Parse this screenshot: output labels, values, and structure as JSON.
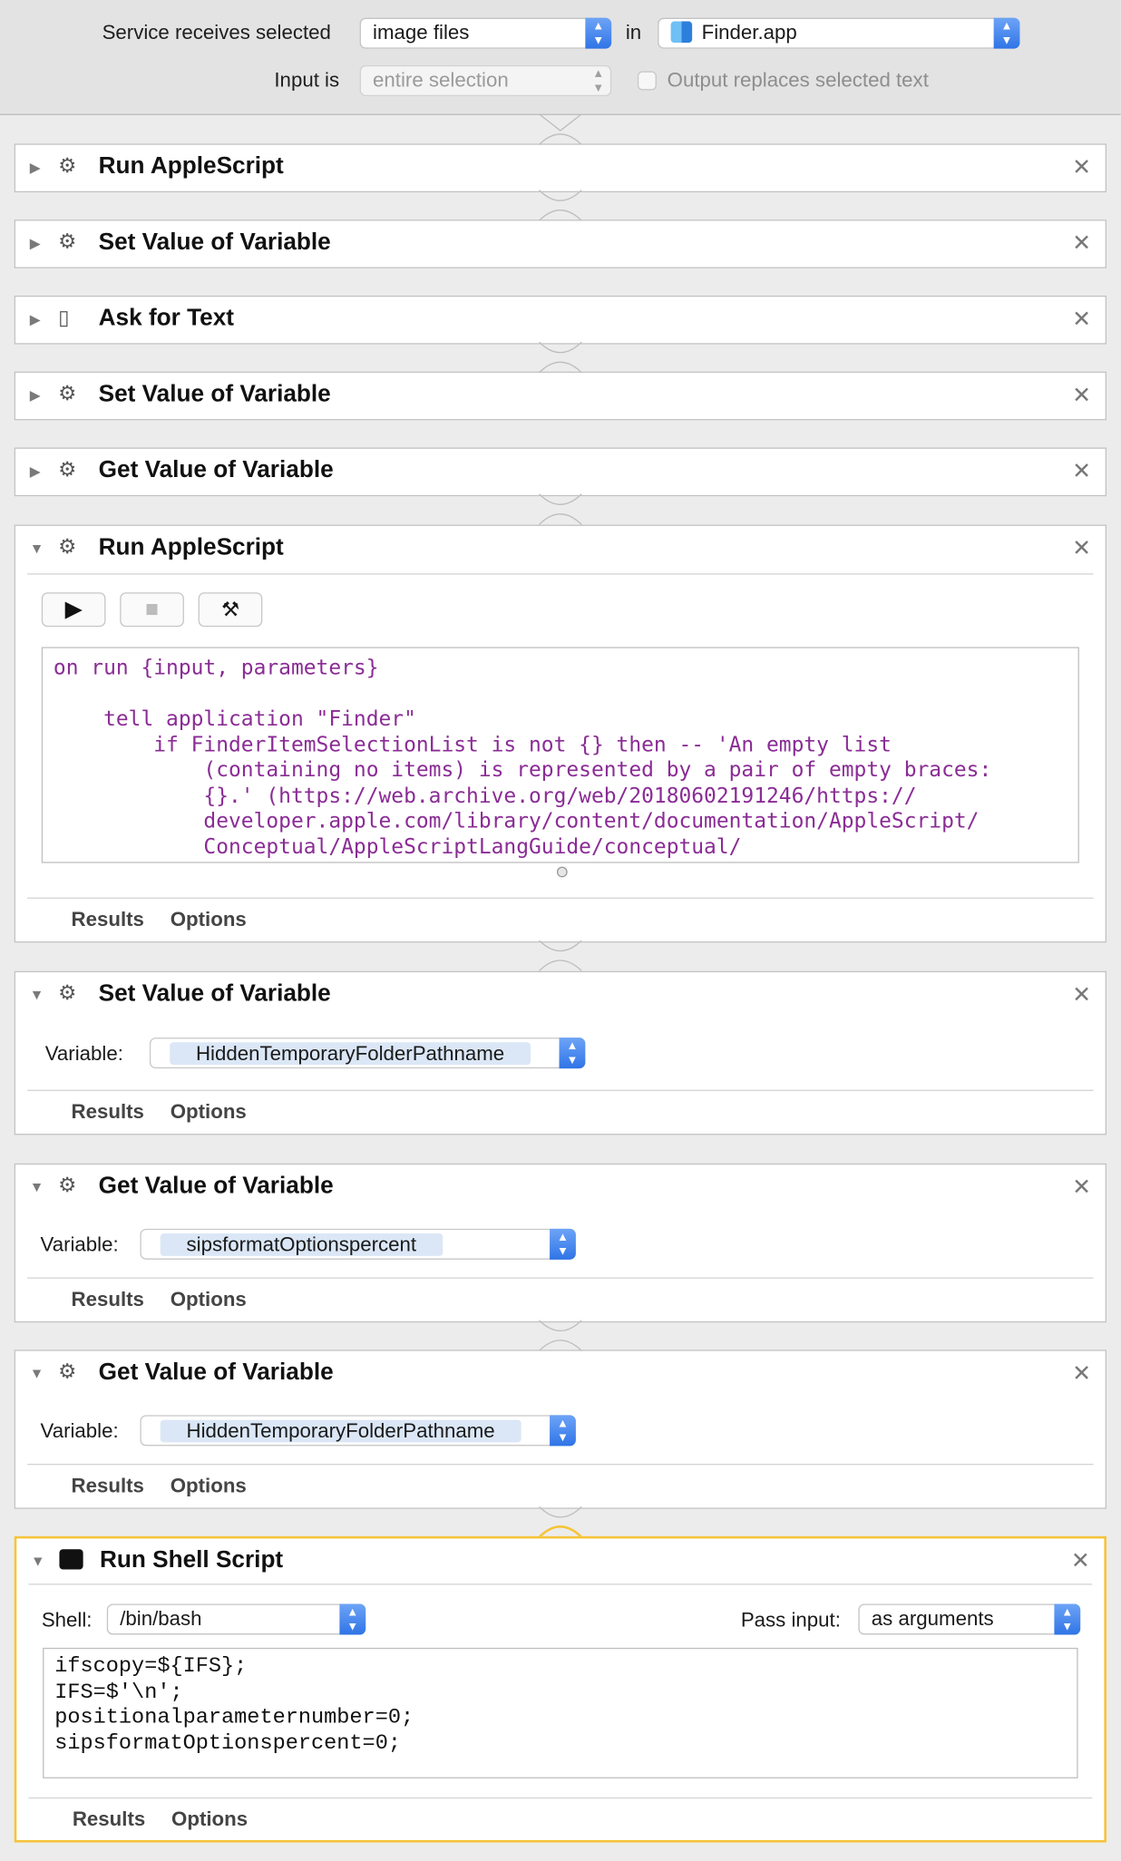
{
  "header": {
    "service_label": "Service receives selected",
    "service_value": "image files",
    "in_label": "in",
    "app_value": "Finder.app",
    "input_label": "Input is",
    "input_value": "entire selection",
    "output_label": "Output replaces selected text"
  },
  "tabs": {
    "results": "Results",
    "options": "Options"
  },
  "actions": [
    {
      "title": "Run AppleScript",
      "icon": "robot-icon",
      "expanded": false
    },
    {
      "title": "Set Value of Variable",
      "icon": "robot-icon",
      "expanded": false
    },
    {
      "title": "Ask for Text",
      "icon": "note-icon",
      "expanded": false
    },
    {
      "title": "Set Value of Variable",
      "icon": "robot-icon",
      "expanded": false
    },
    {
      "title": "Get Value of Variable",
      "icon": "robot-icon",
      "expanded": false
    },
    {
      "title": "Run AppleScript",
      "icon": "robot-icon",
      "expanded": true,
      "code": "on run {input, parameters}\n\n    tell application \"Finder\"\n        if FinderItemSelectionList is not {} then -- 'An empty list\n            (containing no items) is represented by a pair of empty braces:\n            {}.' (https://web.archive.org/web/20180602191246/https://\n            developer.apple.com/library/content/documentation/AppleScript/\n            Conceptual/AppleScriptLangGuide/conceptual/"
    },
    {
      "title": "Set Value of Variable",
      "icon": "robot-icon",
      "expanded": true,
      "variable_label": "Variable:",
      "variable_value": "HiddenTemporaryFolderPathname"
    },
    {
      "title": "Get Value of Variable",
      "icon": "robot-icon",
      "expanded": true,
      "variable_label": "Variable:",
      "variable_value": "sipsformatOptionspercent"
    },
    {
      "title": "Get Value of Variable",
      "icon": "robot-icon",
      "expanded": true,
      "variable_label": "Variable:",
      "variable_value": "HiddenTemporaryFolderPathname"
    },
    {
      "title": "Run Shell Script",
      "icon": "terminal-icon",
      "expanded": true,
      "selected": true,
      "shell_label": "Shell:",
      "shell_value": "/bin/bash",
      "pass_label": "Pass input:",
      "pass_value": "as arguments",
      "code": "ifscopy=${IFS};\nIFS=$'\\n';\npositionalparameternumber=0;\nsipsformatOptionspercent=0;"
    }
  ],
  "colors": {
    "selection": "#f5c43a",
    "token": "#dbe7f6",
    "applescript": "#8a2c95",
    "stepper": "#2f74e6"
  }
}
